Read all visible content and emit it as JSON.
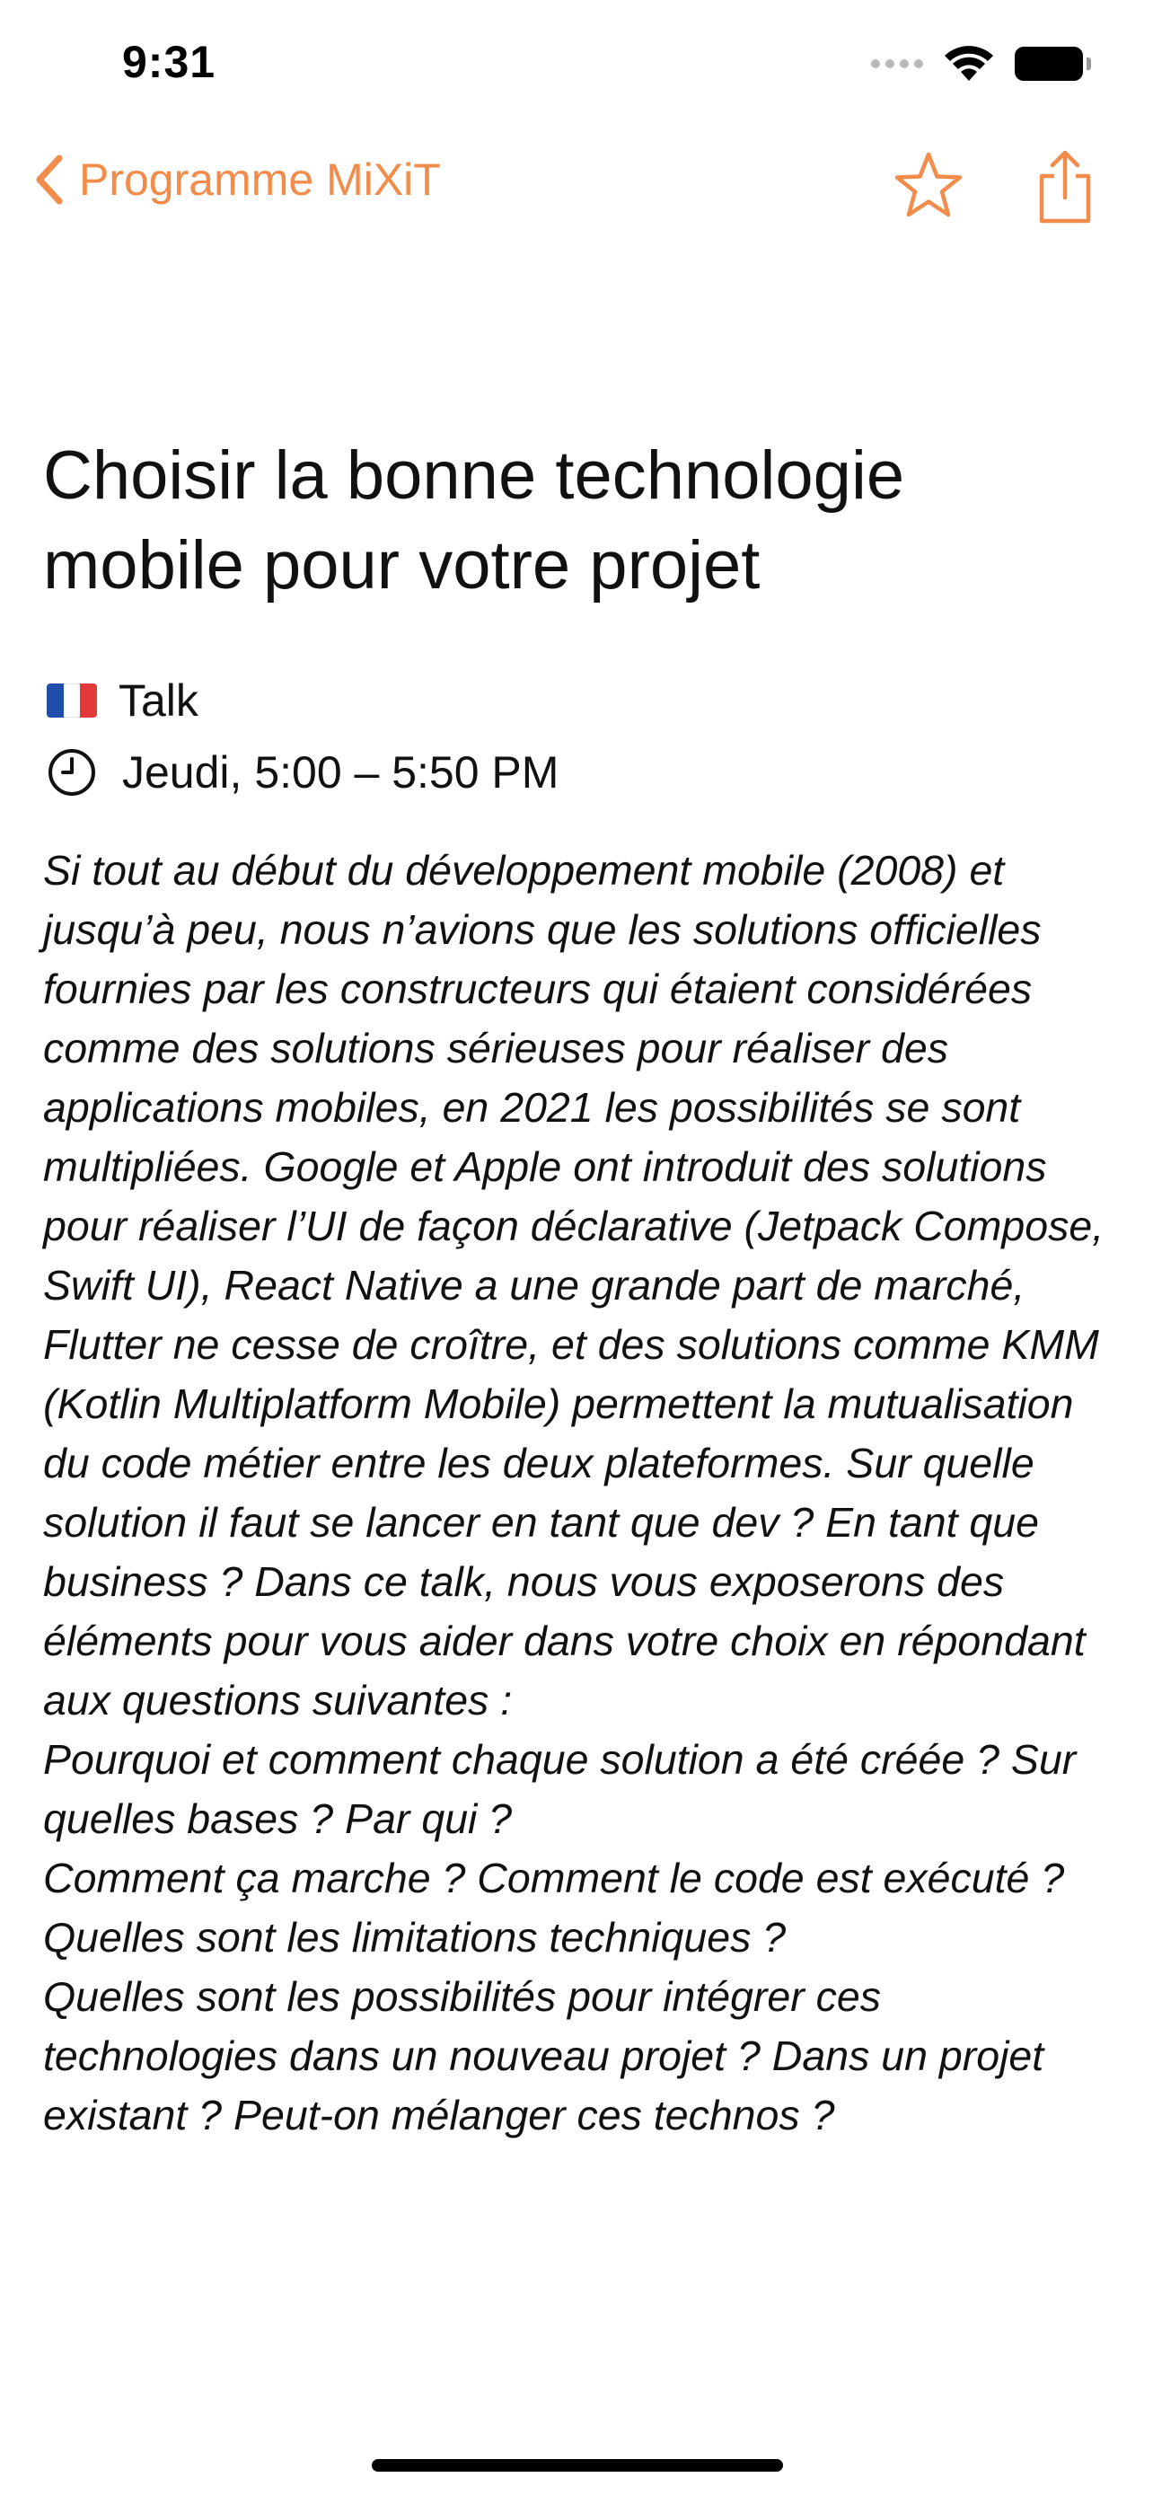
{
  "status_bar": {
    "time": "9:31",
    "signal_icon": "cellular-signal-icon",
    "wifi_icon": "wifi-icon",
    "battery_icon": "battery-icon"
  },
  "nav": {
    "back_label": "Programme MiXiT",
    "back_icon": "chevron-left-icon",
    "star_icon": "star-icon",
    "share_icon": "share-icon",
    "accent_color": "#f28c4a"
  },
  "talk": {
    "title": "Choisir la bonne technologie mobile pour votre projet",
    "flag_icon": "france-flag-icon",
    "format": "Talk",
    "clock_icon": "clock-icon",
    "schedule": "Jeudi, 5:00 – 5:50 PM",
    "description": "Si tout au début du développement mobile (2008) et jusqu’à peu, nous n’avions que les solutions officielles fournies par les constructeurs qui étaient considérées comme des solutions sérieuses pour réaliser des applications mobiles, en 2021 les possibilités se sont multipliées. Google et Apple ont introduit des solutions pour réaliser l’UI de façon déclarative (Jetpack Compose, Swift UI), React Native a une grande part de marché, Flutter ne cesse de croître, et des solutions comme KMM (Kotlin Multiplatform Mobile) permettent la mutualisation du code métier entre les deux plateformes. Sur quelle solution il faut se lancer en tant que dev ? En tant que business ? Dans ce talk, nous vous exposerons des éléments pour vous aider dans votre choix en répondant aux questions suivantes :\nPourquoi et comment chaque solution a été créée ? Sur quelles bases ? Par qui ?\nComment ça marche ? Comment le code est exécuté ? Quelles sont les limitations techniques ?\nQuelles sont les possibilités pour intégrer ces technologies dans un nouveau projet ? Dans un projet existant ? Peut-on mélanger ces technos ?"
  }
}
